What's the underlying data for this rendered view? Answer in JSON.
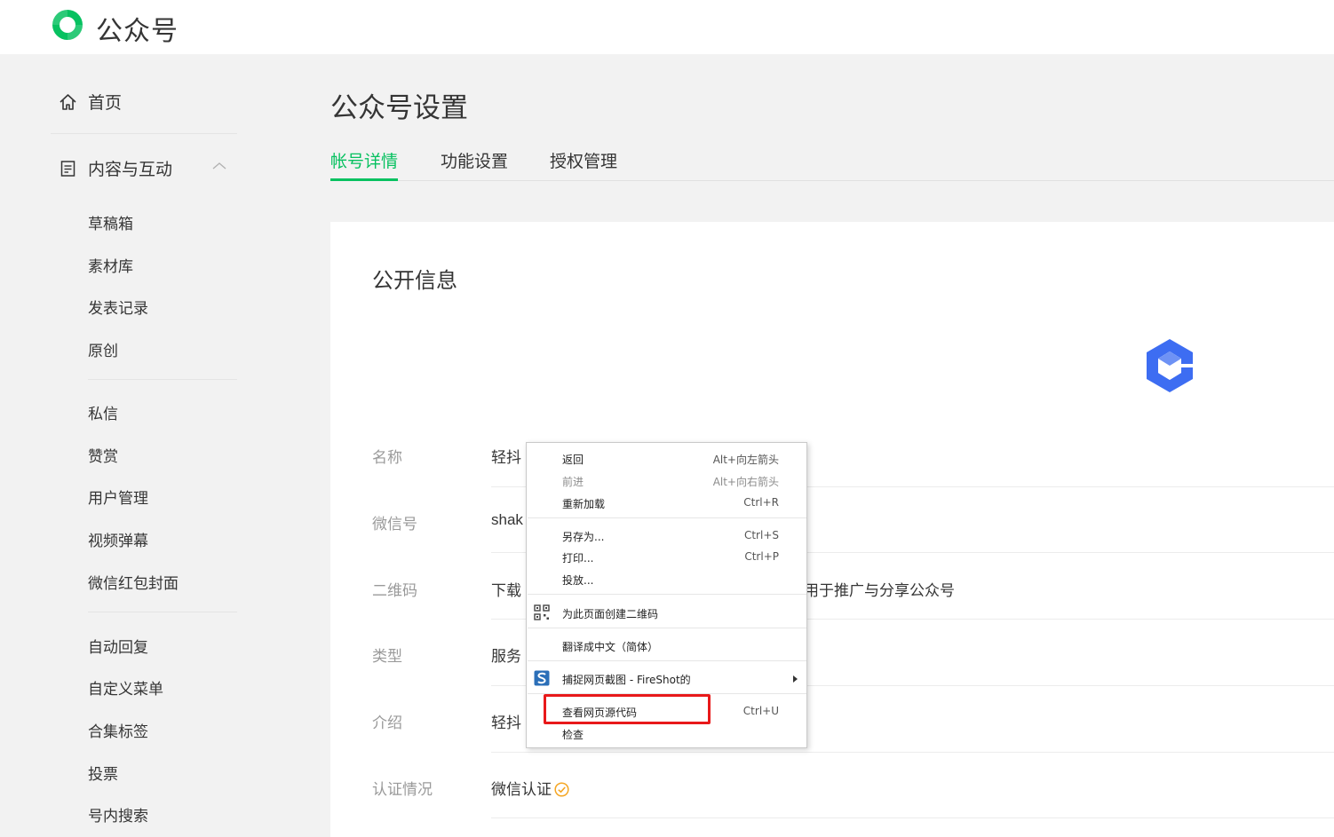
{
  "header": {
    "brand": "公众号"
  },
  "sidebar": {
    "home": "首页",
    "content_group": "内容与互动",
    "items_a": [
      "草稿箱",
      "素材库",
      "发表记录",
      "原创"
    ],
    "items_b": [
      "私信",
      "赞赏",
      "用户管理",
      "视频弹幕",
      "微信红包封面"
    ],
    "items_c": [
      "自动回复",
      "自定义菜单",
      "合集标签",
      "投票",
      "号内搜索"
    ]
  },
  "main": {
    "title": "公众号设置",
    "tabs": [
      "帐号详情",
      "功能设置",
      "授权管理"
    ],
    "section_title": "公开信息",
    "fields": [
      {
        "label": "名称",
        "value": "轻抖"
      },
      {
        "label": "微信号",
        "value": "shak"
      },
      {
        "label": "二维码",
        "value": "下载",
        "tail": "用于推广与分享公众号"
      },
      {
        "label": "类型",
        "value": "服务"
      },
      {
        "label": "介绍",
        "value": "轻抖"
      },
      {
        "label": "认证情况",
        "value": "微信认证"
      }
    ]
  },
  "context_menu": {
    "back": {
      "label": "返回",
      "shortcut": "Alt+向左箭头"
    },
    "forward": {
      "label": "前进",
      "shortcut": "Alt+向右箭头"
    },
    "reload": {
      "label": "重新加载",
      "shortcut": "Ctrl+R"
    },
    "save_as": {
      "label": "另存为...",
      "shortcut": "Ctrl+S"
    },
    "print": {
      "label": "打印...",
      "shortcut": "Ctrl+P"
    },
    "cast": {
      "label": "投放..."
    },
    "qr": {
      "label": "为此页面创建二维码"
    },
    "translate": {
      "label": "翻译成中文（简体）"
    },
    "fireshot": {
      "label": "捕捉网页截图 - FireShot的"
    },
    "view_source": {
      "label": "查看网页源代码",
      "shortcut": "Ctrl+U"
    },
    "inspect": {
      "label": "检查"
    }
  },
  "colors": {
    "accent": "#07c160",
    "highlight": "#e8191a",
    "avatar": "#3d6df2"
  }
}
